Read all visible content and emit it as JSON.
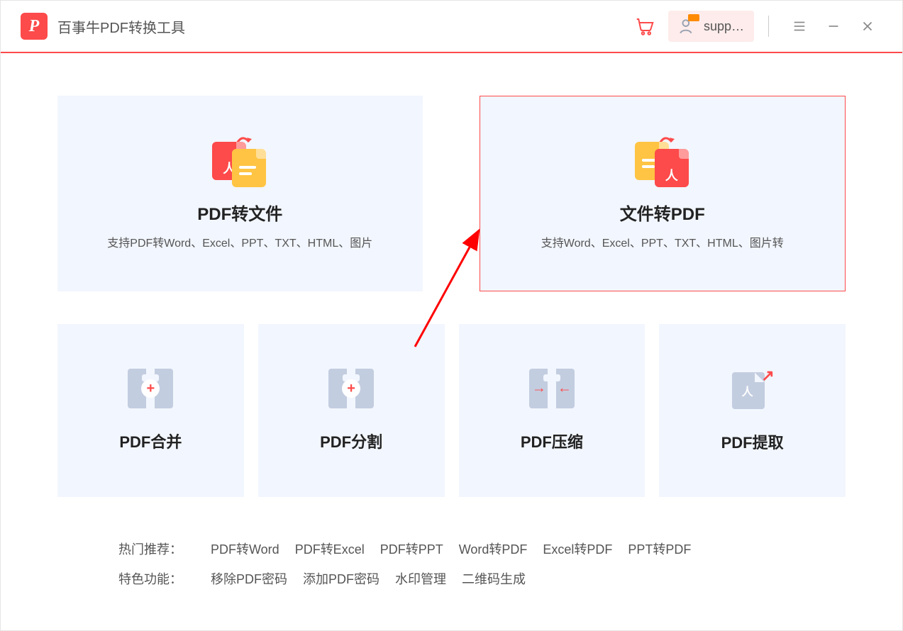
{
  "header": {
    "app_title": "百事牛PDF转换工具",
    "logo_letter": "P",
    "user_label": "supp…"
  },
  "big_cards": [
    {
      "title": "PDF转文件",
      "sub": "支持PDF转Word、Excel、PPT、TXT、HTML、图片"
    },
    {
      "title": "文件转PDF",
      "sub": "支持Word、Excel、PPT、TXT、HTML、图片转"
    }
  ],
  "small_cards": [
    {
      "title": "PDF合并"
    },
    {
      "title": "PDF分割"
    },
    {
      "title": "PDF压缩"
    },
    {
      "title": "PDF提取"
    }
  ],
  "footer": {
    "hot_label": "热门推荐：",
    "hot_links": [
      "PDF转Word",
      "PDF转Excel",
      "PDF转PPT",
      "Word转PDF",
      "Excel转PDF",
      "PPT转PDF"
    ],
    "feat_label": "特色功能：",
    "feat_links": [
      "移除PDF密码",
      "添加PDF密码",
      "水印管理",
      "二维码生成"
    ]
  },
  "glyphs": {
    "lambda": "人"
  }
}
